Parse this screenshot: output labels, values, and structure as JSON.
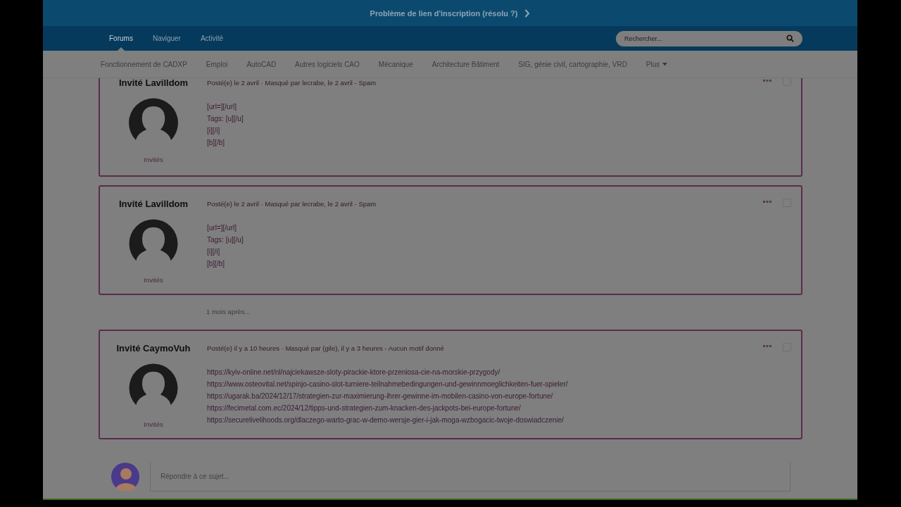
{
  "announcement": {
    "text": "Problème de lien d'inscription (résolu ?)"
  },
  "nav": {
    "tabs": [
      {
        "label": "Forums",
        "selected": true
      },
      {
        "label": "Naviguer",
        "selected": false
      },
      {
        "label": "Activité",
        "selected": false
      }
    ],
    "search": {
      "placeholder": "Rechercher..."
    }
  },
  "categories": [
    "Fonctionnement de CADXP",
    "Emploi",
    "AutoCAD",
    "Autres logiciels CAO",
    "Mécanique",
    "Architecture Bâtiment",
    "SIG, génie civil, cartographie, VRD"
  ],
  "more_menu": {
    "label": "Plus"
  },
  "posts": [
    {
      "author": "Invité Lavilldom",
      "group": "Invités",
      "meta": "Posté(e) le 2 avril · Masqué par lecrabe, le 2 avril - Spam",
      "selected": false,
      "lines": [
        "[url=][/url]",
        "Tags: [u][/u]",
        "[i][/i]",
        "[b][/b]"
      ]
    },
    {
      "author": "Invité Lavilldom",
      "group": "Invités",
      "meta": "Posté(e) le 2 avril · Masqué par lecrabe, le 2 avril - Spam",
      "selected": false,
      "lines": [
        "[url=][/url]",
        "Tags: [u][/u]",
        "[i][/i]",
        "[b][/b]"
      ]
    },
    {
      "separator": "1 mois après..."
    },
    {
      "author": "Invité CaymoVuh",
      "group": "Invités",
      "meta": "Posté(e) il y a 10 heures · Masqué par (gile), il y a 3 heures - Aucun motif donné",
      "selected": false,
      "lines": [
        "https://kyiv-online.net/nl/najciekawsze-sloty-pirackie-ktore-przeniosa-cie-na-morskie-przygody/",
        "https://www.osteovital.net/spinjo-casino-slot-turniere-teilnahmebedingungen-und-gewinnmoeglichkeiten-fuer-spieler/",
        "https://ugarak.ba/2024/12/17/strategien-zur-maximierung-ihrer-gewinne-im-mobilen-casino-von-europe-fortune/",
        "https://fecimetal.com.ec/2024/12/tipps-und-strategien-zum-knacken-des-jackpots-bei-europe-fortune/",
        "https://securelivelihoods.org/dlaczego-warto-grac-w-demo-wersje-gier-i-jak-moga-wzbogacic-twoje-doswiadczenie/"
      ]
    }
  ],
  "reply": {
    "placeholder": "Répondre à ce sujet..."
  }
}
